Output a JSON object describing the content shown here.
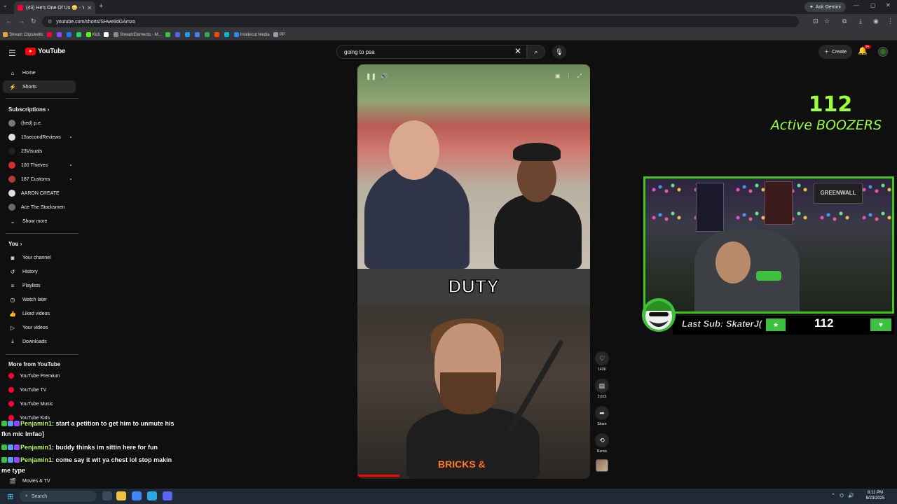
{
  "browser": {
    "tab_title": "(43) He's One Of Us 😳 - Y",
    "url": "youtube.com/shorts/SHwe9dGAmzo",
    "ask_gemini": "Ask Gemini",
    "bookmarks": [
      {
        "label": "Stream Clips/edits",
        "color": "#e8a33d"
      },
      {
        "label": "",
        "color": "#ff0033"
      },
      {
        "label": "",
        "color": "#9146ff"
      },
      {
        "label": "",
        "color": "#1877f2"
      },
      {
        "label": "",
        "color": "#25d366"
      },
      {
        "label": "Kick",
        "color": "#53fc18"
      },
      {
        "label": "",
        "color": "#ffffff"
      },
      {
        "label": "StreamElements - M...",
        "color": "#8a8a8a"
      },
      {
        "label": "",
        "color": "#3ec13e"
      },
      {
        "label": "",
        "color": "#5865f2"
      },
      {
        "label": "",
        "color": "#1da1f2"
      },
      {
        "label": "",
        "color": "#4285f4"
      },
      {
        "label": "",
        "color": "#34a853"
      },
      {
        "label": "",
        "color": "#ff4500"
      },
      {
        "label": "",
        "color": "#00bcd4"
      },
      {
        "label": "Insidecut Media",
        "color": "#3b82f6"
      },
      {
        "label": "PP",
        "color": "#9aa0a6"
      }
    ]
  },
  "youtube": {
    "logo_text": "YouTube",
    "search_value": "going to psa",
    "create_label": "Create",
    "notif_badge": "9+",
    "sidebar": {
      "home": "Home",
      "shorts": "Shorts",
      "subscriptions_heading": "Subscriptions",
      "subscriptions": [
        {
          "label": "(hed) p.e.",
          "color": "#777777"
        },
        {
          "label": "15secondReviews",
          "color": "#e0e0e0"
        },
        {
          "label": "23Visuals",
          "color": "#222222"
        },
        {
          "label": "100 Thieves",
          "color": "#d32f2f"
        },
        {
          "label": "187 Customs",
          "color": "#b23a3a"
        },
        {
          "label": "AARON CREATE",
          "color": "#dddddd"
        },
        {
          "label": "Ace The Stocksmen",
          "color": "#6a6a6a"
        }
      ],
      "show_more": "Show more",
      "you_heading": "You",
      "you_items": [
        {
          "label": "Your channel",
          "icon": "channel-icon"
        },
        {
          "label": "History",
          "icon": "history-icon"
        },
        {
          "label": "Playlists",
          "icon": "playlists-icon"
        },
        {
          "label": "Watch later",
          "icon": "watch-later-icon"
        },
        {
          "label": "Liked videos",
          "icon": "liked-icon"
        },
        {
          "label": "Your videos",
          "icon": "your-videos-icon"
        },
        {
          "label": "Downloads",
          "icon": "downloads-icon"
        }
      ],
      "more_heading": "More from YouTube",
      "more_items": [
        {
          "label": "YouTube Premium",
          "color": "#ff0033"
        },
        {
          "label": "YouTube TV",
          "color": "#ff0033"
        },
        {
          "label": "YouTube Music",
          "color": "#ff0033"
        },
        {
          "label": "YouTube Kids",
          "color": "#ff0033"
        }
      ],
      "movies_tv": "Movies & TV"
    },
    "short": {
      "caption": "DUTY",
      "shirt_text": "BRICKS &",
      "actions": {
        "likes": "142K",
        "comments": "2,615",
        "share": "Share",
        "remix": "Remix"
      }
    }
  },
  "overlay": {
    "active_count": "112",
    "active_label": "Active BOOZERS",
    "banner_text": "GREENWALL",
    "last_sub": "Last Sub: SkaterJ(",
    "sub_count": "112",
    "chat": [
      {
        "user": "Penjamin1",
        "msg": ": start a petition to get him to unmute his fkn mic lmfao]"
      },
      {
        "user": "Penjamin1",
        "msg": ": buddy thinks im sittin here for fun"
      },
      {
        "user": "Penjamin1",
        "msg": ": come say it wit ya chest lol stop makin me type"
      }
    ]
  },
  "taskbar": {
    "search_label": "Search",
    "time": "8:11 PM",
    "date": "8/23/2025"
  }
}
